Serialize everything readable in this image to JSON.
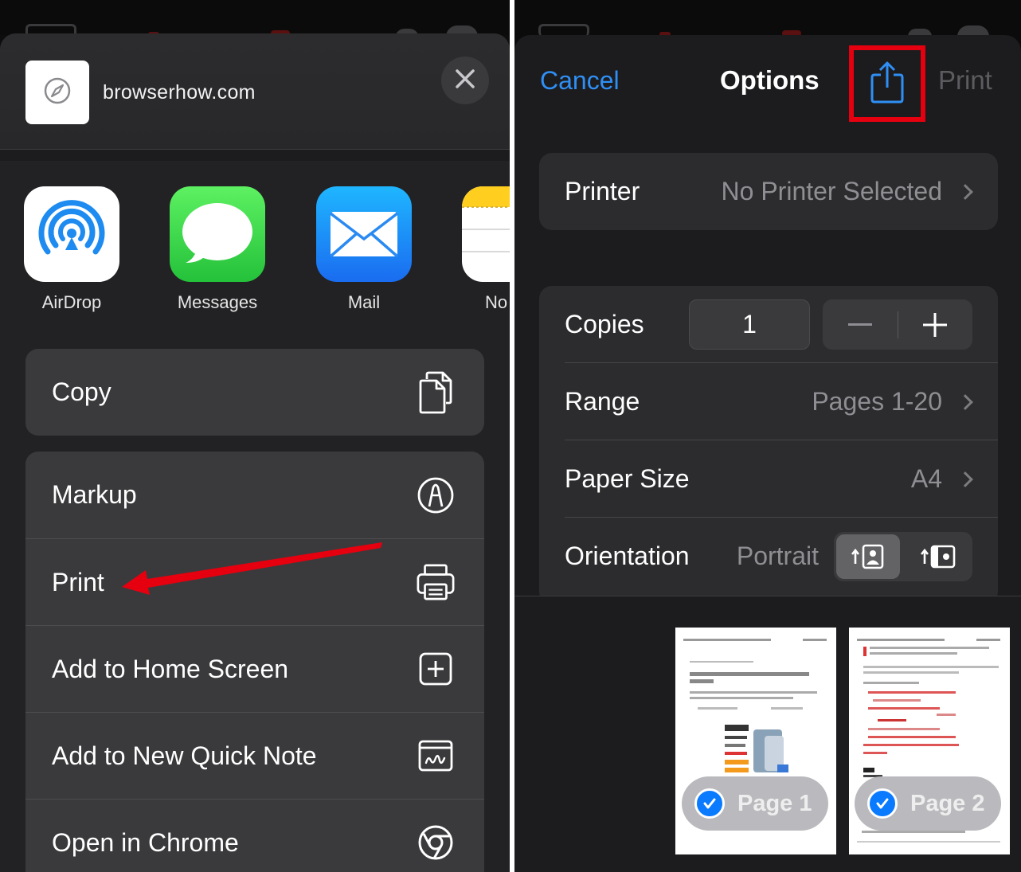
{
  "share_sheet": {
    "site": {
      "name": "browserhow.com",
      "thumbnail_icon": "compass-icon"
    },
    "close_icon": "close-icon",
    "apps": [
      {
        "label": "AirDrop",
        "icon": "airdrop-icon"
      },
      {
        "label": "Messages",
        "icon": "messages-icon"
      },
      {
        "label": "Mail",
        "icon": "mail-icon"
      },
      {
        "label": "No",
        "icon": "notes-icon"
      }
    ],
    "actions_group1": [
      {
        "label": "Copy",
        "icon": "copy-icon"
      }
    ],
    "actions_group2": [
      {
        "label": "Markup",
        "icon": "markup-icon"
      },
      {
        "label": "Print",
        "icon": "printer-icon"
      },
      {
        "label": "Add to Home Screen",
        "icon": "add-square-icon"
      },
      {
        "label": "Add to New Quick Note",
        "icon": "quick-note-icon"
      },
      {
        "label": "Open in Chrome",
        "icon": "chrome-icon"
      }
    ],
    "annotation_color": "#e6000f"
  },
  "print_options": {
    "cancel_label": "Cancel",
    "title": "Options",
    "share_icon": "share-icon",
    "print_label": "Print",
    "printer": {
      "label": "Printer",
      "value": "No Printer Selected"
    },
    "copies": {
      "label": "Copies",
      "value": "1",
      "minus": "−",
      "plus": "+"
    },
    "range": {
      "label": "Range",
      "value": "Pages 1-20"
    },
    "paper_size": {
      "label": "Paper Size",
      "value": "A4"
    },
    "orientation": {
      "label": "Orientation",
      "value": "Portrait",
      "selected": "portrait"
    },
    "pages": [
      {
        "label": "Page 1",
        "selected": true
      },
      {
        "label": "Page 2",
        "selected": true
      }
    ],
    "accent_color": "#2f8ff5"
  }
}
